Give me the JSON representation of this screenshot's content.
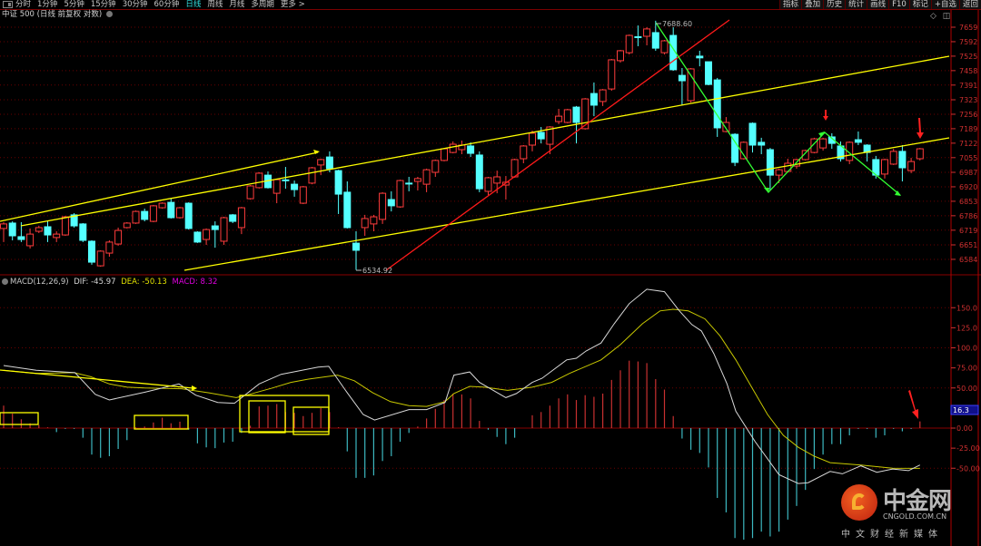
{
  "toolbar": {
    "periods": [
      "分时",
      "1分钟",
      "5分钟",
      "15分钟",
      "30分钟",
      "60分钟",
      "日线",
      "周线",
      "月线",
      "多周期",
      "更多 >"
    ],
    "active_period": "日线",
    "tools": [
      "指标",
      "叠加",
      "历史",
      "统计",
      "画线",
      "F10",
      "标记",
      "+自选",
      "返回"
    ]
  },
  "title": "中证 500 (日线 前复权 对数)",
  "macd_header": {
    "name": "MACD(12,26,9)",
    "dif": "DIF: -45.97",
    "dea": "DEA: -50.13",
    "macd": "MACD: 8.32"
  },
  "macd_cursor_value": "16.3",
  "annotations": {
    "low_label": "6534.92",
    "high_label": "7688.60"
  },
  "logo": {
    "cn": "中金网",
    "en": "CNGOLD.COM.CN",
    "sub": "中文财经新媒体"
  },
  "colors": {
    "up": "#ff3c3c",
    "down": "#54ffff",
    "dif": "#d8d8d8",
    "dea": "#c8c800",
    "grid": "#6a0000",
    "axis": "#d03030"
  },
  "chart_data": [
    {
      "type": "candlestick",
      "title": "中证 500 (日线 前复权 对数)",
      "ylim": [
        6500,
        7700
      ],
      "y_ticks": [
        7659,
        7592,
        7525,
        7458,
        7391,
        7323,
        7256,
        7189,
        7122,
        7055,
        6987,
        6920,
        6853,
        6786,
        6719,
        6651,
        6584
      ],
      "ohlc": [
        [
          6727,
          6756,
          6664,
          6748
        ],
        [
          6752,
          6760,
          6672,
          6693
        ],
        [
          6689,
          6756,
          6664,
          6676
        ],
        [
          6647,
          6727,
          6634,
          6701
        ],
        [
          6714,
          6740,
          6706,
          6731
        ],
        [
          6735,
          6764,
          6664,
          6697
        ],
        [
          6685,
          6714,
          6664,
          6701
        ],
        [
          6697,
          6785,
          6693,
          6781
        ],
        [
          6790,
          6798,
          6731,
          6739
        ],
        [
          6748,
          6752,
          6664,
          6672
        ],
        [
          6668,
          6672,
          6559,
          6571
        ],
        [
          6554,
          6626,
          6550,
          6622
        ],
        [
          6613,
          6672,
          6596,
          6664
        ],
        [
          6655,
          6731,
          6647,
          6718
        ],
        [
          6731,
          6756,
          6727,
          6752
        ],
        [
          6752,
          6810,
          6748,
          6806
        ],
        [
          6806,
          6819,
          6760,
          6769
        ],
        [
          6760,
          6836,
          6756,
          6832
        ],
        [
          6823,
          6848,
          6819,
          6844
        ],
        [
          6848,
          6865,
          6773,
          6777
        ],
        [
          6777,
          6827,
          6773,
          6823
        ],
        [
          6844,
          6848,
          6722,
          6727
        ],
        [
          6710,
          6714,
          6660,
          6664
        ],
        [
          6676,
          6727,
          6651,
          6722
        ],
        [
          6739,
          6760,
          6638,
          6722
        ],
        [
          6668,
          6781,
          6651,
          6777
        ],
        [
          6790,
          6794,
          6752,
          6760
        ],
        [
          6731,
          6827,
          6701,
          6823
        ],
        [
          6865,
          6928,
          6861,
          6924
        ],
        [
          6916,
          6987,
          6912,
          6983
        ],
        [
          6974,
          6991,
          6912,
          6916
        ],
        [
          6890,
          6957,
          6844,
          6953
        ],
        [
          6952,
          7012,
          6911,
          6949
        ],
        [
          6932,
          6949,
          6874,
          6907
        ],
        [
          6844,
          6924,
          6840,
          6920
        ],
        [
          6937,
          7012,
          6932,
          7008
        ],
        [
          7021,
          7050,
          6974,
          7046
        ],
        [
          7058,
          7084,
          6987,
          7004
        ],
        [
          6995,
          6999,
          6794,
          6886
        ],
        [
          6895,
          6945,
          6727,
          6731
        ],
        [
          6659,
          6714,
          6535,
          6626
        ],
        [
          6731,
          6790,
          6693,
          6773
        ],
        [
          6748,
          6790,
          6714,
          6781
        ],
        [
          6769,
          6895,
          6748,
          6890
        ],
        [
          6861,
          6899,
          6806,
          6832
        ],
        [
          6827,
          6953,
          6823,
          6949
        ],
        [
          6937,
          6966,
          6899,
          6934
        ],
        [
          6945,
          6966,
          6903,
          6958
        ],
        [
          6932,
          7004,
          6895,
          6999
        ],
        [
          6987,
          7046,
          6966,
          7042
        ],
        [
          7042,
          7100,
          7038,
          7096
        ],
        [
          7079,
          7130,
          7075,
          7117
        ],
        [
          7092,
          7134,
          7071,
          7113
        ],
        [
          7109,
          7126,
          7058,
          7075
        ],
        [
          7067,
          7084,
          6895,
          6911
        ],
        [
          6899,
          6966,
          6882,
          6962
        ],
        [
          6937,
          6995,
          6890,
          6966
        ],
        [
          6928,
          6970,
          6861,
          6941
        ],
        [
          6966,
          7050,
          6962,
          7046
        ],
        [
          7050,
          7113,
          7029,
          7109
        ],
        [
          7113,
          7180,
          7084,
          7168
        ],
        [
          7172,
          7197,
          7121,
          7142
        ],
        [
          7117,
          7201,
          7071,
          7197
        ],
        [
          7222,
          7281,
          7210,
          7247
        ],
        [
          7218,
          7281,
          7214,
          7277
        ],
        [
          7289,
          7294,
          7121,
          7218
        ],
        [
          7189,
          7331,
          7185,
          7327
        ],
        [
          7352,
          7403,
          7247,
          7298
        ],
        [
          7315,
          7373,
          7294,
          7369
        ],
        [
          7373,
          7512,
          7365,
          7508
        ],
        [
          7504,
          7554,
          7495,
          7550
        ],
        [
          7541,
          7625,
          7533,
          7621
        ],
        [
          7615,
          7667,
          7571,
          7611
        ],
        [
          7617,
          7659,
          7575,
          7651
        ],
        [
          7634,
          7689,
          7550,
          7562
        ],
        [
          7541,
          7600,
          7533,
          7596
        ],
        [
          7621,
          7659,
          7457,
          7462
        ],
        [
          7436,
          7470,
          7298,
          7411
        ],
        [
          7319,
          7470,
          7310,
          7466
        ],
        [
          7525,
          7550,
          7478,
          7517
        ],
        [
          7499,
          7499,
          7390,
          7394
        ],
        [
          7415,
          7424,
          7151,
          7193
        ],
        [
          7176,
          7243,
          7172,
          7218
        ],
        [
          7163,
          7168,
          7016,
          7033
        ],
        [
          7050,
          7130,
          7046,
          7126
        ],
        [
          7214,
          7218,
          7079,
          7113
        ],
        [
          7126,
          7147,
          7071,
          7113
        ],
        [
          7092,
          7100,
          6903,
          6974
        ],
        [
          6974,
          7004,
          6937,
          6999
        ],
        [
          6991,
          7050,
          6987,
          7029
        ],
        [
          7016,
          7050,
          7004,
          7046
        ],
        [
          7046,
          7092,
          7042,
          7088
        ],
        [
          7079,
          7147,
          7075,
          7142
        ],
        [
          7100,
          7147,
          7088,
          7142
        ],
        [
          7151,
          7168,
          7096,
          7121
        ],
        [
          7109,
          7130,
          7037,
          7050
        ],
        [
          7042,
          7130,
          7025,
          7126
        ],
        [
          7138,
          7176,
          7113,
          7126
        ],
        [
          7113,
          7117,
          7037,
          7079
        ],
        [
          7046,
          7063,
          6958,
          6974
        ],
        [
          6979,
          7050,
          6958,
          7046
        ],
        [
          7025,
          7096,
          7021,
          7084
        ],
        [
          7084,
          7113,
          6945,
          7008
        ],
        [
          6995,
          7054,
          6983,
          7037
        ],
        [
          7050,
          7100,
          7042,
          7096
        ]
      ]
    },
    {
      "type": "bar+line",
      "title": "MACD(12,26,9)",
      "ylim": [
        -70,
        190
      ],
      "y_ticks": [
        "150.0",
        "125.0",
        "100.0",
        "75.00",
        "50.00",
        "0.00",
        "-25.00",
        "-50.00"
      ],
      "y_tick_values": [
        150,
        125,
        100,
        75,
        50,
        0,
        -25,
        -50
      ],
      "grid_values": [
        150,
        100,
        50,
        0,
        -50
      ],
      "histogram": [
        28,
        18,
        11,
        6,
        4,
        1,
        -5,
        -1,
        -1,
        -12,
        -33,
        -37,
        -35,
        -26,
        -15,
        1,
        2,
        7,
        13,
        6,
        8,
        -2,
        -19,
        -24,
        -25,
        -18,
        -17,
        -6,
        3,
        27,
        28,
        30,
        20,
        19,
        15,
        19,
        25,
        20,
        1,
        -29,
        -62,
        -62,
        -59,
        -41,
        -35,
        -17,
        -6,
        2,
        12,
        24,
        35,
        43,
        42,
        37,
        9,
        -2,
        -11,
        -20,
        -12,
        0,
        16,
        20,
        28,
        37,
        42,
        35,
        41,
        39,
        43,
        60,
        72,
        84,
        83,
        81,
        61,
        48,
        15,
        -13,
        -27,
        -31,
        -49,
        -87,
        -105,
        -137,
        -139,
        -137,
        -129,
        -135,
        -129,
        -114,
        -97,
        -77,
        -51,
        -33,
        -20,
        -20,
        -9,
        -1,
        -1,
        -12,
        -9,
        -1,
        -4,
        -1,
        8.32
      ],
      "dif": [
        [
          0,
          78
        ],
        [
          3.7,
          72
        ],
        [
          8.1,
          69
        ],
        [
          10.4,
          42
        ],
        [
          12,
          35
        ],
        [
          16.1,
          45
        ],
        [
          19.9,
          55
        ],
        [
          21.8,
          41
        ],
        [
          24.3,
          32
        ],
        [
          26.2,
          31
        ],
        [
          29,
          55
        ],
        [
          31.5,
          67
        ],
        [
          35.7,
          76
        ],
        [
          36.9,
          77
        ],
        [
          38.8,
          47
        ],
        [
          40.8,
          17
        ],
        [
          42.1,
          10
        ],
        [
          46,
          23
        ],
        [
          48,
          23
        ],
        [
          50.1,
          32
        ],
        [
          51.1,
          66
        ],
        [
          52.9,
          70
        ],
        [
          54,
          57
        ],
        [
          57,
          38
        ],
        [
          58.2,
          43
        ],
        [
          60,
          57
        ],
        [
          61.1,
          62
        ],
        [
          63.9,
          85
        ],
        [
          65,
          87
        ],
        [
          66.1,
          96
        ],
        [
          67.8,
          106
        ],
        [
          69.3,
          130
        ],
        [
          71,
          155
        ],
        [
          73,
          173
        ],
        [
          75,
          170
        ],
        [
          76.7,
          146
        ],
        [
          78.1,
          129
        ],
        [
          79.2,
          121
        ],
        [
          80.6,
          93
        ],
        [
          82.1,
          55
        ],
        [
          83.1,
          21
        ],
        [
          85.3,
          -17
        ],
        [
          88,
          -58
        ],
        [
          90.2,
          -69
        ],
        [
          91.3,
          -68
        ],
        [
          93.8,
          -54
        ],
        [
          95.2,
          -57
        ],
        [
          97.3,
          -47
        ],
        [
          99.1,
          -55
        ],
        [
          100.9,
          -51
        ],
        [
          102.7,
          -53
        ],
        [
          104,
          -45.97
        ]
      ],
      "dea": [
        [
          0,
          72
        ],
        [
          3.7,
          68
        ],
        [
          8,
          69
        ],
        [
          9.9,
          64
        ],
        [
          12,
          55
        ],
        [
          14,
          51
        ],
        [
          16,
          50
        ],
        [
          20.2,
          49
        ],
        [
          23.3,
          44
        ],
        [
          26.4,
          38
        ],
        [
          27.9,
          42
        ],
        [
          30.5,
          50
        ],
        [
          32.6,
          57
        ],
        [
          34.6,
          61
        ],
        [
          37.9,
          66
        ],
        [
          39.8,
          59
        ],
        [
          41.9,
          44
        ],
        [
          43.9,
          33
        ],
        [
          46,
          28
        ],
        [
          48,
          27
        ],
        [
          50.1,
          33
        ],
        [
          51.1,
          43
        ],
        [
          52.9,
          52
        ],
        [
          54.6,
          51
        ],
        [
          57.2,
          47
        ],
        [
          60,
          51
        ],
        [
          62.2,
          57
        ],
        [
          64.2,
          68
        ],
        [
          67.8,
          85
        ],
        [
          70,
          104
        ],
        [
          72.5,
          130
        ],
        [
          74.5,
          146
        ],
        [
          76,
          148
        ],
        [
          77.7,
          146
        ],
        [
          79.6,
          136
        ],
        [
          81.3,
          115
        ],
        [
          83.1,
          85
        ],
        [
          84.9,
          51
        ],
        [
          86.7,
          17
        ],
        [
          88.5,
          -9
        ],
        [
          90.2,
          -24
        ],
        [
          92,
          -35
        ],
        [
          93.8,
          -43
        ],
        [
          97.3,
          -46
        ],
        [
          100.9,
          -50
        ],
        [
          104,
          -50.13
        ]
      ]
    }
  ]
}
